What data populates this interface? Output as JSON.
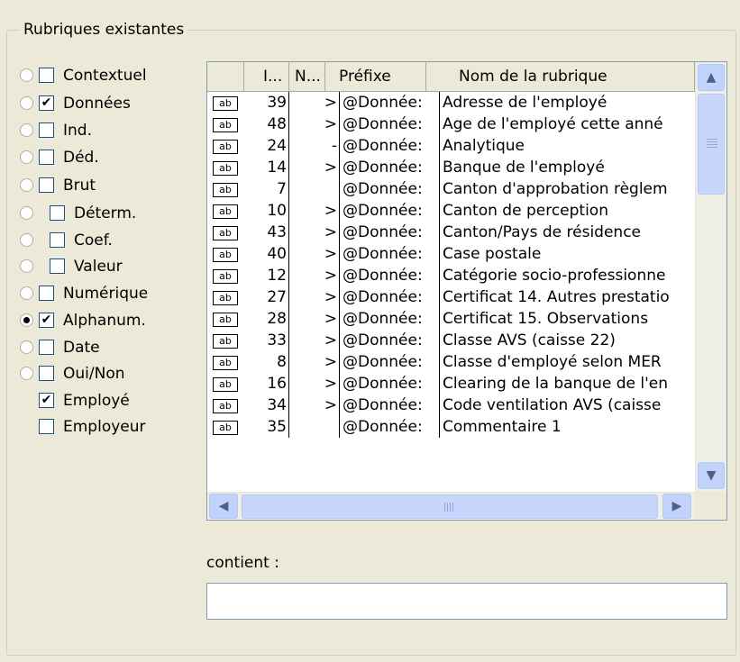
{
  "group_title": "Rubriques existantes",
  "filters": [
    {
      "label": "Contextuel",
      "checked": false,
      "radio": true,
      "radio_selected": false,
      "indent": 0
    },
    {
      "label": "Données",
      "checked": true,
      "radio": true,
      "radio_selected": false,
      "indent": 0
    },
    {
      "label": "Ind.",
      "checked": false,
      "radio": true,
      "radio_selected": false,
      "indent": 0
    },
    {
      "label": "Déd.",
      "checked": false,
      "radio": true,
      "radio_selected": false,
      "indent": 0
    },
    {
      "label": "Brut",
      "checked": false,
      "radio": true,
      "radio_selected": false,
      "indent": 0
    },
    {
      "label": "Déterm.",
      "checked": false,
      "radio": true,
      "radio_selected": false,
      "indent": 1
    },
    {
      "label": "Coef.",
      "checked": false,
      "radio": true,
      "radio_selected": false,
      "indent": 1
    },
    {
      "label": "Valeur",
      "checked": false,
      "radio": true,
      "radio_selected": false,
      "indent": 1
    },
    {
      "label": "Numérique",
      "checked": false,
      "radio": true,
      "radio_selected": false,
      "indent": 0
    },
    {
      "label": "Alphanum.",
      "checked": true,
      "radio": true,
      "radio_selected": true,
      "indent": 0
    },
    {
      "label": "Date",
      "checked": false,
      "radio": true,
      "radio_selected": false,
      "indent": 0
    },
    {
      "label": "Oui/Non",
      "checked": false,
      "radio": true,
      "radio_selected": false,
      "indent": 0
    },
    {
      "label": "Employé",
      "checked": true,
      "radio": false,
      "radio_selected": false,
      "indent": 0
    },
    {
      "label": "Employeur",
      "checked": false,
      "radio": false,
      "radio_selected": false,
      "indent": 0
    }
  ],
  "grid": {
    "columns": [
      "",
      "I...",
      "N...",
      "Préfixe",
      "Nom de la rubrique"
    ],
    "type_icon_text": "ab",
    "rows": [
      {
        "id": "39",
        "n": ">",
        "prefix": "@Donnée:",
        "name": "Adresse de l'employé"
      },
      {
        "id": "48",
        "n": ">",
        "prefix": "@Donnée:",
        "name": "Age de l'employé cette anné"
      },
      {
        "id": "24",
        "n": "-",
        "prefix": "@Donnée:",
        "name": "Analytique"
      },
      {
        "id": "14",
        "n": ">",
        "prefix": "@Donnée:",
        "name": "Banque de l'employé"
      },
      {
        "id": "7",
        "n": "",
        "prefix": "@Donnée:",
        "name": "Canton d'approbation règlem"
      },
      {
        "id": "10",
        "n": ">",
        "prefix": "@Donnée:",
        "name": "Canton de perception"
      },
      {
        "id": "43",
        "n": ">",
        "prefix": "@Donnée:",
        "name": "Canton/Pays de résidence"
      },
      {
        "id": "40",
        "n": ">",
        "prefix": "@Donnée:",
        "name": "Case postale"
      },
      {
        "id": "12",
        "n": ">",
        "prefix": "@Donnée:",
        "name": "Catégorie socio-professionne"
      },
      {
        "id": "27",
        "n": ">",
        "prefix": "@Donnée:",
        "name": "Certificat 14. Autres prestatio"
      },
      {
        "id": "28",
        "n": ">",
        "prefix": "@Donnée:",
        "name": "Certificat 15. Observations"
      },
      {
        "id": "33",
        "n": ">",
        "prefix": "@Donnée:",
        "name": "Classe AVS (caisse 22)"
      },
      {
        "id": "8",
        "n": ">",
        "prefix": "@Donnée:",
        "name": "Classe d'employé selon MER"
      },
      {
        "id": "16",
        "n": ">",
        "prefix": "@Donnée:",
        "name": "Clearing de la banque de l'en"
      },
      {
        "id": "34",
        "n": ">",
        "prefix": "@Donnée:",
        "name": "Code ventilation AVS (caisse"
      },
      {
        "id": "35",
        "n": "",
        "prefix": "@Donnée:",
        "name": "Commentaire 1"
      }
    ]
  },
  "contains": {
    "label": "contient :",
    "value": ""
  }
}
